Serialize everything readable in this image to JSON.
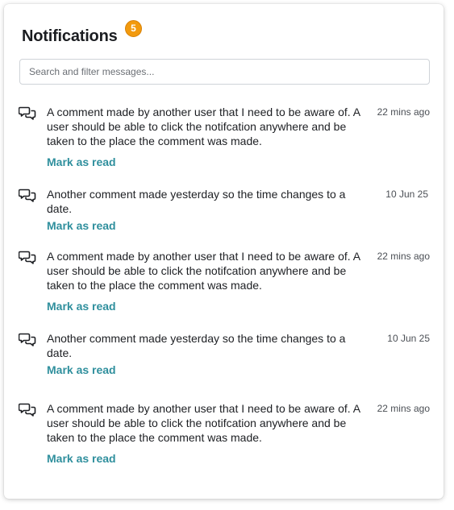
{
  "header": {
    "title": "Notifications",
    "badge_count": "5",
    "badge_color": "#f29a0e"
  },
  "search": {
    "placeholder": "Search and filter messages...",
    "value": ""
  },
  "accent_color": "#2f8f9d",
  "notifications": [
    {
      "icon": "comments-icon",
      "message": "A comment made by another user that I need to be aware of. A user should be able to click the notifcation anywhere and be taken to the place the comment was made.",
      "time": "22 mins ago",
      "action": "Mark as read"
    },
    {
      "icon": "comments-icon",
      "message": "Another comment made yesterday so the time changes to a date.",
      "time": "10 Jun 25",
      "action": "Mark as read"
    },
    {
      "icon": "comments-icon",
      "message": "A comment made by another user that I need to be aware of. A user should be able to click the notifcation anywhere and be taken to the place the comment was made.",
      "time": "22 mins ago",
      "action": "Mark as read"
    },
    {
      "icon": "comments-icon",
      "message": "Another comment made yesterday so the time changes to a date.",
      "time": "10 Jun 25",
      "action": "Mark as read"
    },
    {
      "icon": "comments-icon",
      "message": "A comment made by another user that I need to be aware of. A user should be able to click the notifcation anywhere and be taken to the place the comment was made.",
      "time": "22 mins ago",
      "action": "Mark as read"
    }
  ]
}
